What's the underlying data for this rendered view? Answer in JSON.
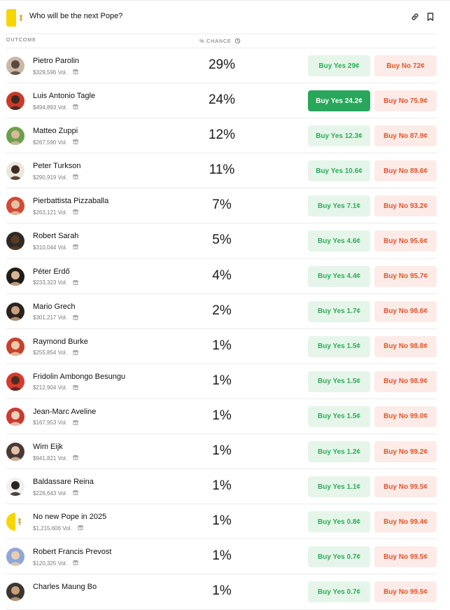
{
  "header": {
    "title": "Who will be the next Pope?",
    "flag_colors": [
      "#f7d600",
      "#ffffff"
    ],
    "icons": [
      "link-icon",
      "bookmark-icon"
    ]
  },
  "columns": {
    "outcome": "OUTCOME",
    "chance": "% CHANCE"
  },
  "colors": {
    "yes_bg": "#e6f5ea",
    "yes_text": "#2bae56",
    "yes_active_bg": "#27a75a",
    "no_bg": "#fdebe8",
    "no_text": "#e2562b"
  },
  "rows": [
    {
      "name": "Pietro Parolin",
      "volume": "$329,596 Vol.",
      "chance": "29%",
      "yes": "Buy Yes 29¢",
      "no": "Buy No 72¢",
      "yes_active": false,
      "avatar_bg": "#c9b8a8",
      "avatar_fg": "#5a4a3e"
    },
    {
      "name": "Luis Antonio Tagle",
      "volume": "$494,893 Vol.",
      "chance": "24%",
      "yes": "Buy Yes 24.2¢",
      "no": "Buy No 75.9¢",
      "yes_active": true,
      "avatar_bg": "#c93a2b",
      "avatar_fg": "#3b2a20"
    },
    {
      "name": "Matteo Zuppi",
      "volume": "$267,590 Vol.",
      "chance": "12%",
      "yes": "Buy Yes 12.3¢",
      "no": "Buy No 87.9¢",
      "yes_active": false,
      "avatar_bg": "#6aa04c",
      "avatar_fg": "#d9b89a"
    },
    {
      "name": "Peter Turkson",
      "volume": "$290,919 Vol.",
      "chance": "11%",
      "yes": "Buy Yes 10.6¢",
      "no": "Buy No 89.6¢",
      "yes_active": false,
      "avatar_bg": "#ebe6dc",
      "avatar_fg": "#3d2b1f"
    },
    {
      "name": "Pierbattista Pizzaballa",
      "volume": "$263,121 Vol.",
      "chance": "7%",
      "yes": "Buy Yes 7.1¢",
      "no": "Buy No 93.2¢",
      "yes_active": false,
      "avatar_bg": "#d24a36",
      "avatar_fg": "#e2c2a4"
    },
    {
      "name": "Robert Sarah",
      "volume": "$310,044 Vol.",
      "chance": "5%",
      "yes": "Buy Yes 4.6¢",
      "no": "Buy No 95.6¢",
      "yes_active": false,
      "avatar_bg": "#2e2a26",
      "avatar_fg": "#5a3b28"
    },
    {
      "name": "Péter Erdő",
      "volume": "$233,323 Vol.",
      "chance": "4%",
      "yes": "Buy Yes 4.4¢",
      "no": "Buy No 95.7¢",
      "yes_active": false,
      "avatar_bg": "#1f1c1a",
      "avatar_fg": "#d7b592"
    },
    {
      "name": "Mario Grech",
      "volume": "$301,217 Vol.",
      "chance": "2%",
      "yes": "Buy Yes 1.7¢",
      "no": "Buy No 98.6¢",
      "yes_active": false,
      "avatar_bg": "#2b2320",
      "avatar_fg": "#c9a07d"
    },
    {
      "name": "Raymond Burke",
      "volume": "$255,854 Vol.",
      "chance": "1%",
      "yes": "Buy Yes 1.5¢",
      "no": "Buy No 98.8¢",
      "yes_active": false,
      "avatar_bg": "#c8402c",
      "avatar_fg": "#e8c9ad"
    },
    {
      "name": "Fridolin Ambongo Besungu",
      "volume": "$212,904 Vol.",
      "chance": "1%",
      "yes": "Buy Yes 1.5¢",
      "no": "Buy No 98.9¢",
      "yes_active": false,
      "avatar_bg": "#d63b2e",
      "avatar_fg": "#4a2d1f"
    },
    {
      "name": "Jean-Marc Aveline",
      "volume": "$167,953 Vol.",
      "chance": "1%",
      "yes": "Buy Yes 1.5¢",
      "no": "Buy No 99.0¢",
      "yes_active": false,
      "avatar_bg": "#c93b30",
      "avatar_fg": "#ecd2bb"
    },
    {
      "name": "Wim Eijk",
      "volume": "$941,821 Vol.",
      "chance": "1%",
      "yes": "Buy Yes 1.2¢",
      "no": "Buy No 99.2¢",
      "yes_active": false,
      "avatar_bg": "#4a3a36",
      "avatar_fg": "#e0c2a5"
    },
    {
      "name": "Baldassare Reina",
      "volume": "$226,643 Vol.",
      "chance": "1%",
      "yes": "Buy Yes 1.1¢",
      "no": "Buy No 99.5¢",
      "yes_active": false,
      "avatar_bg": "#f2f0ee",
      "avatar_fg": "#2a2523"
    },
    {
      "name": "No new Pope in 2025",
      "volume": "$1,215,606 Vol.",
      "chance": "1%",
      "yes": "Buy Yes 0.8¢",
      "no": "Buy No 99.4¢",
      "yes_active": false,
      "avatar_bg": "flag",
      "avatar_fg": "#f7d600"
    },
    {
      "name": "Robert Francis Prevost",
      "volume": "$120,325 Vol.",
      "chance": "1%",
      "yes": "Buy Yes 0.7¢",
      "no": "Buy No 99.5¢",
      "yes_active": false,
      "avatar_bg": "#8fa6d6",
      "avatar_fg": "#e8cdb3"
    },
    {
      "name": "Charles Maung Bo",
      "volume": "",
      "chance": "1%",
      "yes": "Buy Yes 0.7¢",
      "no": "Buy No 99.5¢",
      "yes_active": false,
      "avatar_bg": "#3d3532",
      "avatar_fg": "#c79f7c"
    }
  ]
}
